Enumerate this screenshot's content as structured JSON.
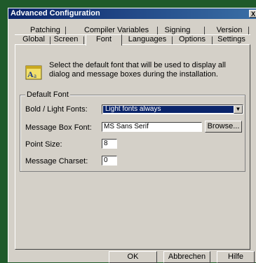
{
  "window": {
    "title": "Advanced Configuration",
    "close_label": "X"
  },
  "tabs": {
    "row1": [
      "Patching",
      "Compiler Variables",
      "Signing",
      "Version"
    ],
    "row2": [
      "Global",
      "Screen",
      "Font",
      "Languages",
      "Options",
      "Settings"
    ],
    "active": "Font"
  },
  "info": {
    "icon": "font-icon",
    "text": "Select the default font that will be used to display all dialog and message boxes during the installation."
  },
  "group": {
    "label": "Default Font",
    "bold_light_label": "Bold / Light Fonts:",
    "bold_light_value": "Light fonts always",
    "message_box_font_label": "Message Box Font:",
    "message_box_font_value": "MS Sans Serif",
    "browse_label": "Browse...",
    "point_size_label": "Point Size:",
    "point_size_value": "8",
    "charset_label": "Message Charset:",
    "charset_value": "0"
  },
  "buttons": {
    "ok": "OK",
    "cancel": "Abbrechen",
    "help": "Hilfe"
  }
}
